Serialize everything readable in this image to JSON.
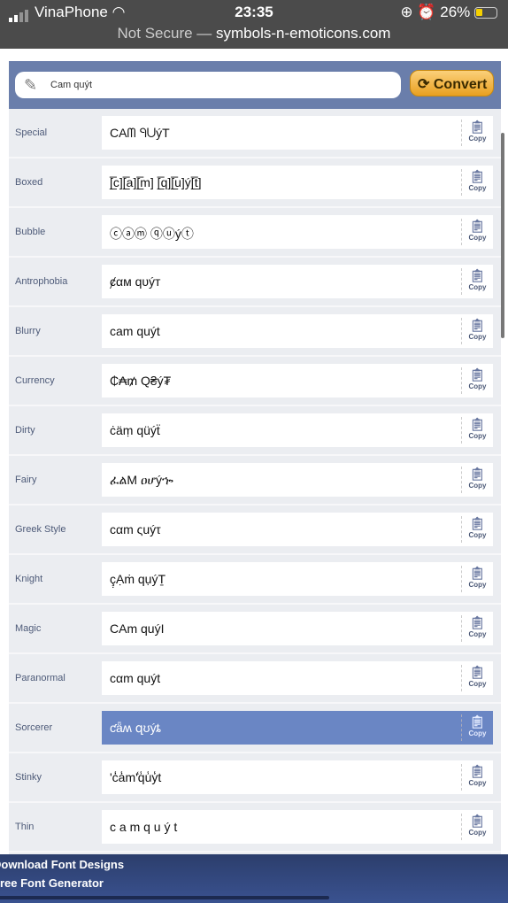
{
  "status": {
    "carrier": "VinaPhone",
    "time": "23:35",
    "battery": "26%"
  },
  "browser": {
    "prefix": "Not Secure —",
    "domain": "symbols-n-emoticons.com"
  },
  "converter": {
    "input_value": "Cam quýt",
    "convert_label": "Convert"
  },
  "copy_label": "Copy",
  "rows": [
    {
      "label": "Special",
      "value": "CAᗰ ᑫᑌýT"
    },
    {
      "label": "Boxed",
      "value": "[̲̅c][̲̅a][̲̅m] [̲̅q][̲̅u]ý[̲̅t]"
    },
    {
      "label": "Bubble",
      "value": "ⓒⓐⓜ ⓠⓤýⓣ"
    },
    {
      "label": "Antrophobia",
      "value": "ȼαм qυýт"
    },
    {
      "label": "Blurry",
      "value": "cam quýt"
    },
    {
      "label": "Currency",
      "value": "₵₳₥ Q₴ý₮"
    },
    {
      "label": "Dirty",
      "value": "ċäṃ qüýẗ"
    },
    {
      "label": "Fairy",
      "value": "ፈልM ዐሆýኈ"
    },
    {
      "label": "Greek Style",
      "value": "cαm ςuýτ"
    },
    {
      "label": "Knight",
      "value": "ç̣Ạṁ qụýṮ"
    },
    {
      "label": "Magic",
      "value": "CAm quýI"
    },
    {
      "label": "Paranormal",
      "value": "cαm quýt"
    },
    {
      "label": "Sorcerer",
      "value": "ƈǟʍ զʊýȶ",
      "selected": true
    },
    {
      "label": "Stinky",
      "value": "'ċ̾ȧ̾m'̾q̾u̾ẏ̾t"
    },
    {
      "label": "Thin",
      "value": "c a m q u ý t"
    }
  ],
  "footer": {
    "link1": "Download Font Designs",
    "link2": "Free Font Generator"
  }
}
